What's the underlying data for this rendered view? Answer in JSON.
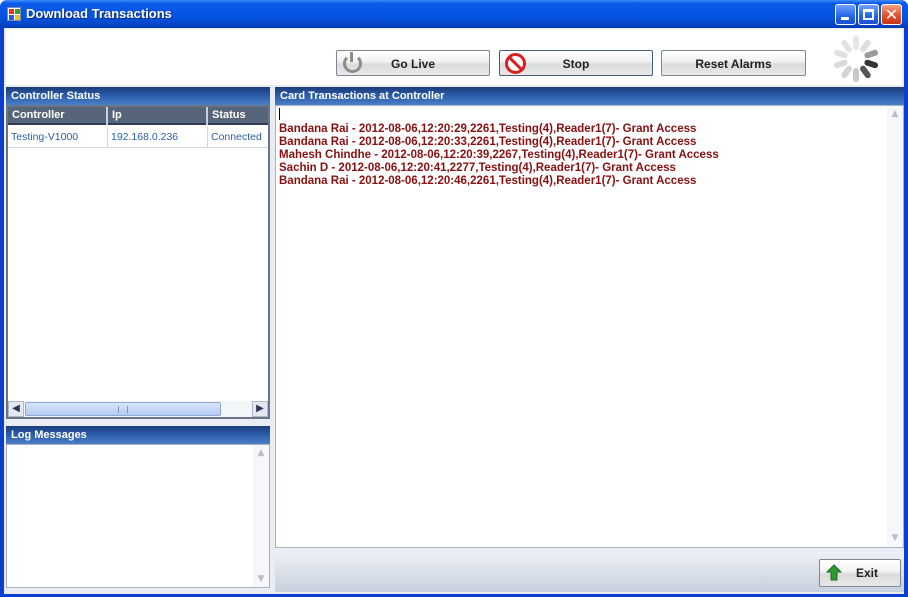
{
  "window": {
    "title": "Download Transactions"
  },
  "toolbar": {
    "go_live_label": "Go Live",
    "stop_label": "Stop",
    "reset_alarms_label": "Reset Alarms"
  },
  "controller_status": {
    "header": "Controller Status",
    "columns": [
      "Controller",
      "Ip",
      "Status"
    ],
    "rows": [
      {
        "controller": "Testing-V1000",
        "ip": "192.168.0.236",
        "status": "Connected"
      }
    ]
  },
  "log_messages": {
    "header": "Log Messages"
  },
  "transactions": {
    "header": "Card Transactions at Controller",
    "lines": [
      "Bandana Rai - 2012-08-06,12:20:29,2261,Testing(4),Reader1(7)- Grant Access",
      "Bandana Rai - 2012-08-06,12:20:33,2261,Testing(4),Reader1(7)- Grant Access",
      "Mahesh Chindhe - 2012-08-06,12:20:39,2267,Testing(4),Reader1(7)- Grant Access",
      "Sachin D - 2012-08-06,12:20:41,2277,Testing(4),Reader1(7)- Grant Access",
      "Bandana Rai - 2012-08-06,12:20:46,2261,Testing(4),Reader1(7)- Grant Access"
    ],
    "text_color": "#8a1010"
  },
  "footer": {
    "exit_label": "Exit"
  },
  "colors": {
    "titlebar": "#0554e3",
    "panel_header": "#2a5aa8",
    "grid_header": "#57657a",
    "grid_text": "#2a5fa8"
  },
  "icons": [
    "app-icon",
    "minimize-icon",
    "maximize-icon",
    "close-icon",
    "power-icon",
    "stop-icon",
    "loading-spinner-icon",
    "exit-arrow-icon"
  ]
}
